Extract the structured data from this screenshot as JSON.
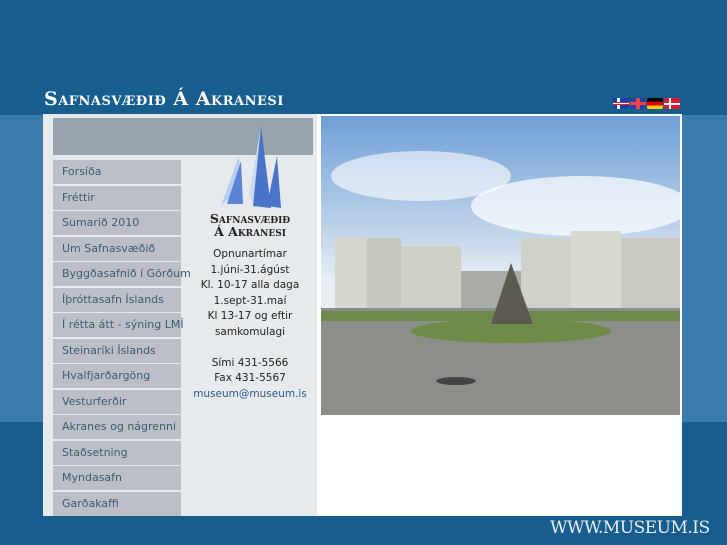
{
  "header": {
    "title": "Safnasvæðið Á Akranesi",
    "languages": [
      "Íslenska",
      "English",
      "Deutsch",
      "Dansk"
    ]
  },
  "nav": [
    "Forsíða",
    "Fréttir",
    "Sumarið 2010",
    "Um Safnasvæðið",
    "Byggðasafnið í Görðum",
    "Íþróttasafn Íslands",
    "Í rétta átt - sýning LMÍ",
    "Steinaríki Íslands",
    "Hvalfjarðargöng",
    "Vesturferðir",
    "Akranes og nágrenni",
    "Staðsetning",
    "Myndasafn",
    "Garðakaffi"
  ],
  "logo": {
    "line1": "Safnasvæðið",
    "line2": "Á Akranesi"
  },
  "info": {
    "l1": "Opnunartímar",
    "l2": "1.júni-31.ágúst",
    "l3": "Kl. 10-17 alla daga",
    "l4": "1.sept-31.maí",
    "l5": "Kl 13-17 og eftir",
    "l6": "samkomulagi",
    "phone": "Sími 431-5566",
    "fax": "Fax 431-5567",
    "email": "museum@museum.is"
  },
  "footer": "WWW.MUSEUM.IS"
}
